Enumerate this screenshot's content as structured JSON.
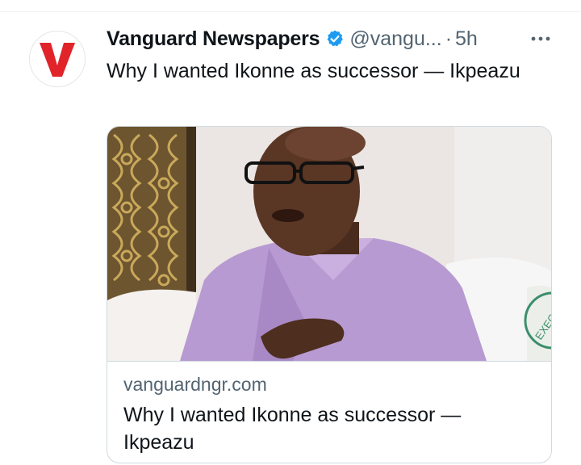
{
  "tweet": {
    "author_name": "Vanguard Newspapers",
    "author_handle": "@vangu...",
    "separator": "·",
    "time": "5h",
    "text": "Why I wanted Ikonne as successor — Ikpeazu",
    "avatar_letter": "V",
    "verified": true
  },
  "card": {
    "domain": "vanguardngr.com",
    "title": "Why I wanted Ikonne as successor — Ikpeazu",
    "image_stamp": "EXECUTI"
  },
  "icons": {
    "verified": "verified-badge-icon",
    "more": "more-options-icon"
  },
  "colors": {
    "brand_red": "#e0242a",
    "verified_blue": "#1d9bf0",
    "secondary_text": "#536471",
    "border": "#cfd9de"
  }
}
